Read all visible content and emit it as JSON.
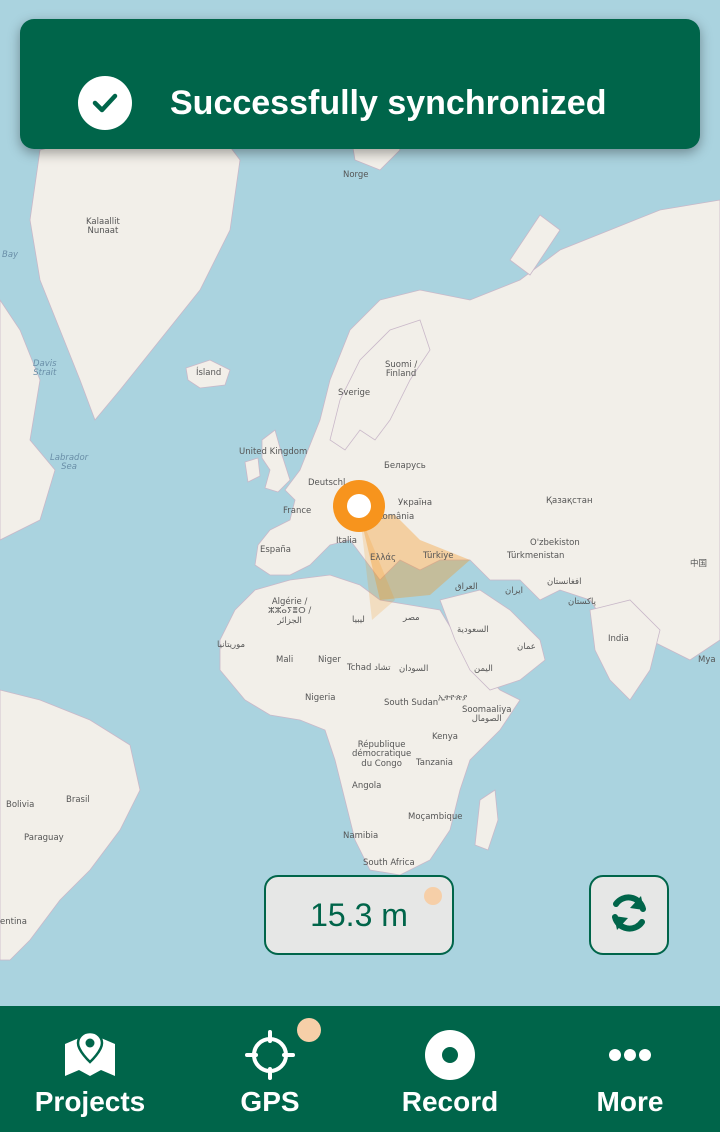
{
  "toast": {
    "message": "Successfully synchronized",
    "icon": "check-circle-icon"
  },
  "map": {
    "labels": {
      "norge": "Norge",
      "kalaallit": "Kalaallit\nNunaat",
      "bay": "Bay",
      "davis": "Davis\nStrait",
      "island": "Ísland",
      "sverige": "Sverige",
      "suomi": "Suomi /\nFinland",
      "labrador": "Labrador\nSea",
      "uk": "United Kingdom",
      "deutschland": "Deutschl",
      "belarus": "Беларусь",
      "ukraina": "Україна",
      "france": "France",
      "romania": "România",
      "kazakhstan": "Қазақстан",
      "italia": "Italia",
      "espana": "España",
      "ellas": "Ελλάς",
      "turkiye": "Türkiye",
      "uzbekiston": "O'zbekiston",
      "turkmenistan": "Türkmenistan",
      "china": "中国",
      "algerie": "Algérie /\nⵣⵣⴰⵢⴻⵔ /\nالجزائر",
      "iraq": "العراق",
      "iran": "ایران",
      "afghanistan": "افغانستان",
      "pakistan": "پاکستان",
      "libya": "ليبيا",
      "misr": "مصر",
      "saudi": "السعودية",
      "oman": "عمان",
      "india": "India",
      "mauritania": "موريتانيا",
      "mali": "Mali",
      "niger": "Niger",
      "tchad": "Tchad تشاد",
      "sudan": "السودان",
      "yemen": "اليمن",
      "ethiopia": "ኢትዮጵያ",
      "nigeria": "Nigeria",
      "south_sudan": "South Sudan",
      "somalia": "Soomaaliya\nالصومال",
      "drc": "République\ndémocratique\ndu Congo",
      "kenya": "Kenya",
      "tanzania": "Tanzania",
      "angola": "Angola",
      "brasil": "Brasil",
      "bolivia": "Bolivia",
      "paraguay": "Paraguay",
      "mocambique": "Moçambique",
      "namibia": "Namibia",
      "south_africa": "South Africa",
      "argentina": "entina",
      "mya": "Mya"
    }
  },
  "accuracy": {
    "value": "15.3 m"
  },
  "sync_button": {
    "icon": "sync-icon"
  },
  "nav": {
    "projects": "Projects",
    "gps": "GPS",
    "record": "Record",
    "more": "More"
  },
  "colors": {
    "brand": "#00654a",
    "marker": "#f7941d",
    "water": "#aad3df",
    "land": "#f2efe9"
  }
}
